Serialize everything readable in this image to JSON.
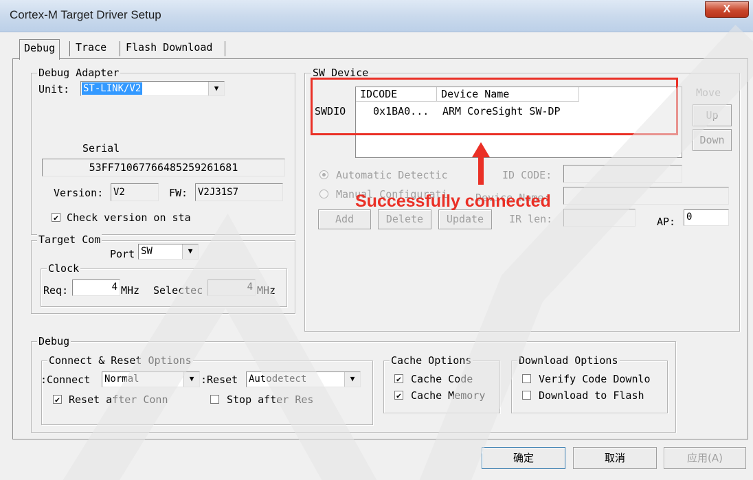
{
  "window": {
    "title": "Cortex-M Target Driver Setup",
    "close_label": "X"
  },
  "tabs": [
    "Debug",
    "Trace",
    "Flash Download"
  ],
  "debug_adapter": {
    "legend": "Debug Adapter",
    "unit_label": "Unit:",
    "unit_value": "ST-LINK/V2",
    "serial_label": "Serial",
    "serial_value": "53FF71067766485259261681",
    "version_label": "Version:",
    "version_value": "V2",
    "fw_label": "FW:",
    "fw_value": "V2J31S7",
    "check_version_label": "Check version on sta"
  },
  "target_com": {
    "legend": "Target Com",
    "port_label": "Port",
    "port_value": "SW",
    "clock_legend": "Clock",
    "req_label": "Req:",
    "req_value": "4",
    "req_unit": "MHz",
    "selected_label": "Selectec",
    "selected_value": "4",
    "selected_unit": "MHz"
  },
  "sw_device": {
    "legend": "SW Device",
    "row_label": "SWDIO",
    "columns": [
      "IDCODE",
      "Device Name"
    ],
    "rows": [
      [
        "0x1BA0...",
        "ARM CoreSight SW-DP"
      ]
    ],
    "move_label": "Move",
    "up_label": "Up",
    "down_label": "Down",
    "auto_detect_label": "Automatic Detectic",
    "manual_config_label": "Manual Configurati",
    "id_code_label": "ID CODE:",
    "device_name_label": "Device Name:",
    "add_label": "Add",
    "delete_label": "Delete",
    "update_label": "Update",
    "ir_len_label": "IR len:",
    "ap_label": "AP:",
    "ap_value": "0"
  },
  "annotation": {
    "text": "Successfully connected",
    "color": "#ea3026"
  },
  "debug": {
    "legend": "Debug",
    "connect_reset_legend": "Connect & Reset Options",
    "connect_label": "Connect:",
    "connect_value": "Normal",
    "reset_label": "Reset:",
    "reset_value": "Autodetect",
    "reset_after_connect_label": "Reset after Conn",
    "stop_after_reset_label": "Stop after Res",
    "cache_legend": "Cache Options",
    "cache_code_label": "Cache Code",
    "cache_memory_label": "Cache Memory",
    "download_legend": "Download Options",
    "verify_code_label": "Verify Code Downlo",
    "download_flash_label": "Download to Flash"
  },
  "buttons": {
    "ok": "确定",
    "cancel": "取消",
    "apply": "应用(A)"
  },
  "checkboxes": {
    "check_version": true,
    "reset_after_connect": true,
    "stop_after_reset": false,
    "cache_code": true,
    "cache_memory": true,
    "verify_code": false,
    "download_flash": false
  }
}
